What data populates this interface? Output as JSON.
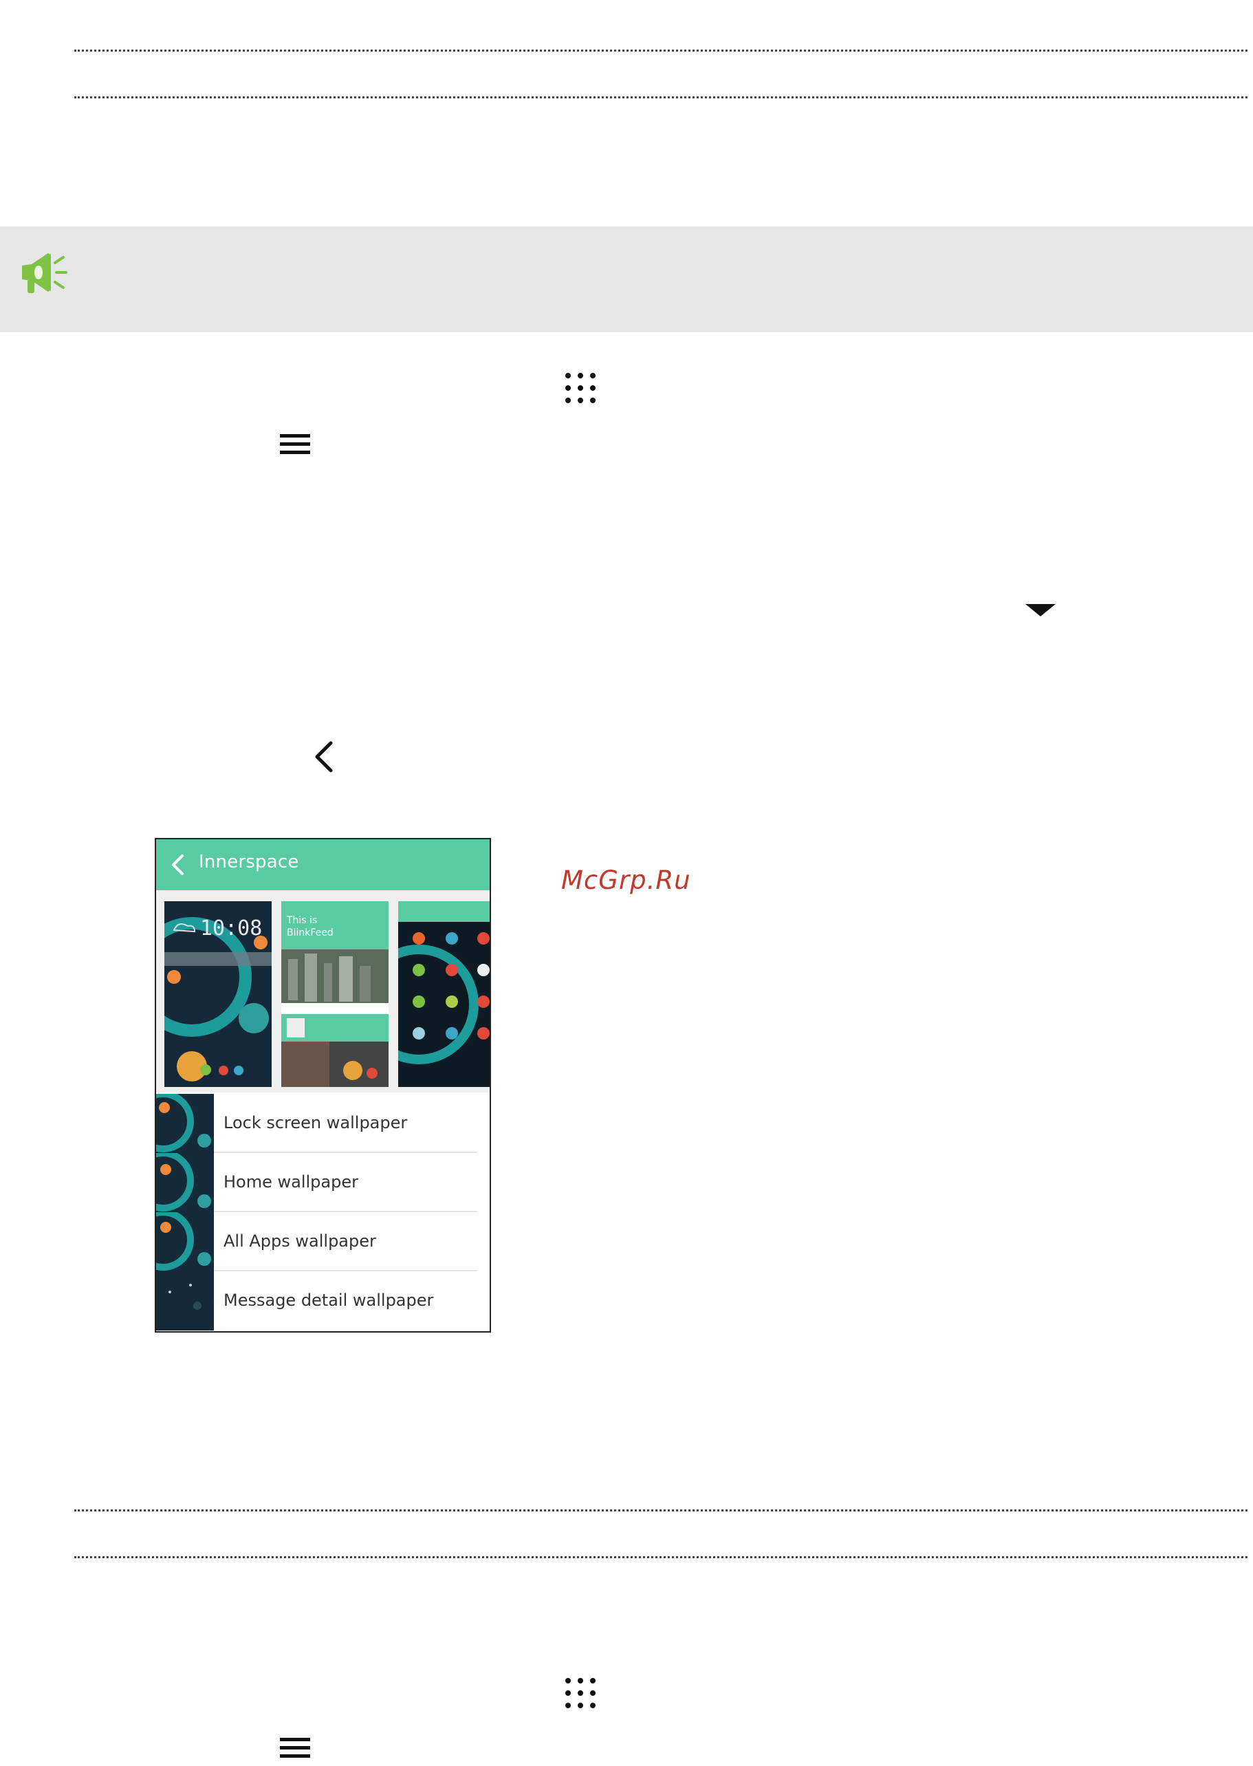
{
  "icons": {
    "tip": "megaphone-icon",
    "apps": "apps-grid-icon",
    "menu": "menu-icon",
    "dropdown": "dropdown-arrow-icon",
    "back": "back-chevron-icon"
  },
  "colors": {
    "tip_band": "#e6e6e6",
    "tip_icon": "#7dc242",
    "phone_header": "#59cba3",
    "watermark": "#c0392b"
  },
  "phone": {
    "header_title": "Innerspace",
    "previews": {
      "lock_time": "10:08",
      "feed_title_line1": "This is",
      "feed_title_line2": "BlinkFeed"
    },
    "wallpaper_options": [
      "Lock screen wallpaper",
      "Home wallpaper",
      "All Apps wallpaper",
      "Message detail wallpaper"
    ]
  },
  "watermark": "McGrp.Ru"
}
